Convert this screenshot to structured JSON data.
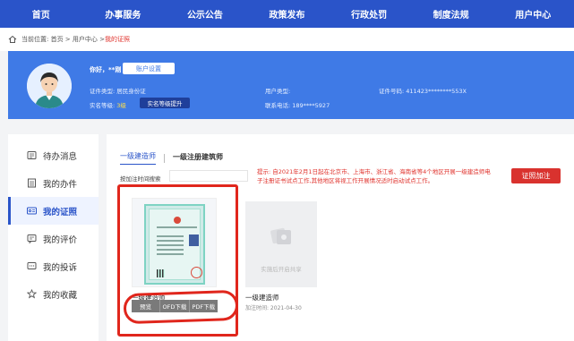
{
  "nav": {
    "items": [
      {
        "label": "首页"
      },
      {
        "label": "办事服务"
      },
      {
        "label": "公示公告"
      },
      {
        "label": "政策发布"
      },
      {
        "label": "行政处罚"
      },
      {
        "label": "制度法规"
      },
      {
        "label": "用户中心"
      }
    ]
  },
  "breadcrumb": {
    "prefix": "当前位置: 首页 > 用户中心 > ",
    "current": "我的证照"
  },
  "profile": {
    "greeting": "你好，**刚",
    "account_button": "账户设置",
    "cert_type_label": "证件类型: 居民身份证",
    "verify_label": "实名等级: ",
    "verify_level": "3级",
    "upgrade_button": "实名等级提升",
    "user_type_label": "用户类型:",
    "phone_label": "联系电话: 189****5927",
    "id_number_label": "证件号码: 411423********553X"
  },
  "sidebar": {
    "items": [
      {
        "label": "待办消息",
        "icon": "message-icon"
      },
      {
        "label": "我的办件",
        "icon": "document-icon"
      },
      {
        "label": "我的证照",
        "icon": "id-card-icon"
      },
      {
        "label": "我的评价",
        "icon": "comment-icon"
      },
      {
        "label": "我的投诉",
        "icon": "complaint-icon"
      },
      {
        "label": "我的收藏",
        "icon": "star-icon"
      }
    ],
    "active_index": 2
  },
  "main": {
    "tabs": [
      {
        "label": "一级建造师"
      },
      {
        "label": "一级注册建筑师"
      }
    ],
    "search_label": "按加注时间搜索",
    "search_placeholder": "",
    "notice": "提示: 自2021年2月1日起在北京市、上海市、浙江省、海南省等4个地区开展一级建造师电子注册证书试点工作,其他地区将视工作开展情况适时启动试点工作。",
    "cert_add_button": "证照加注",
    "cards": [
      {
        "title": "一级建造师",
        "actions": [
          "预览",
          "OFD下载",
          "PDF下载"
        ]
      },
      {
        "title": "一级建造师",
        "placeholder": "实施后开启共享",
        "time": "加注时间: 2021-04-30"
      }
    ]
  },
  "colors": {
    "nav_bg": "#2a54c9",
    "banner_bg": "#3f7ae6",
    "accent_red": "#d9322e",
    "highlight": "#e0261c"
  }
}
